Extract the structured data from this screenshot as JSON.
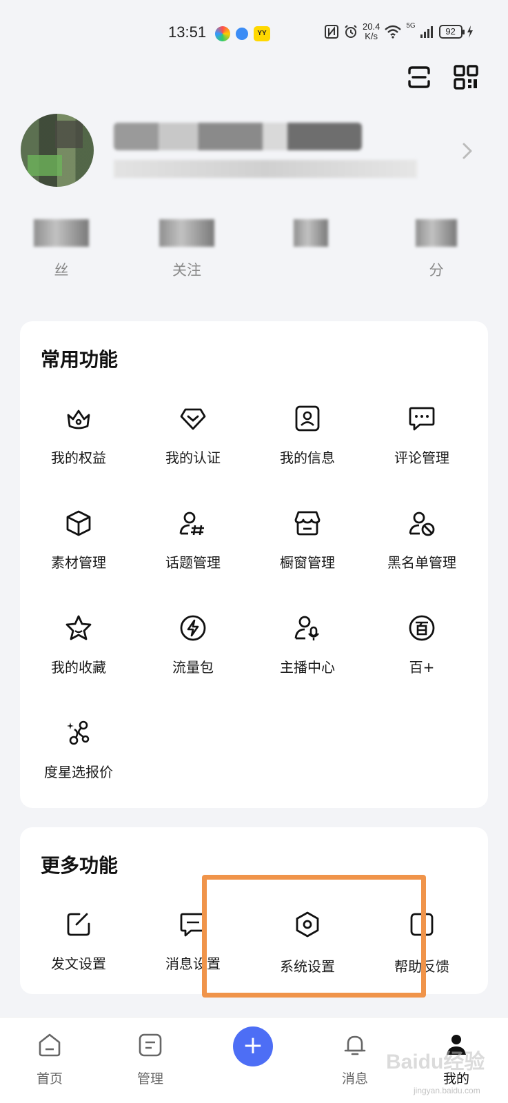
{
  "status_bar": {
    "time": "13:51",
    "net_speed_value": "20.4",
    "net_speed_unit": "K/s",
    "signal": "5G",
    "battery": "92",
    "yy_label": "YY"
  },
  "profile": {
    "stats": [
      {
        "label": "丝"
      },
      {
        "label": "关注"
      },
      {
        "label": ""
      },
      {
        "label": "分"
      }
    ]
  },
  "common_functions": {
    "title": "常用功能",
    "items": [
      {
        "label": "我的权益",
        "icon": "crown-icon"
      },
      {
        "label": "我的认证",
        "icon": "verify-shield-icon"
      },
      {
        "label": "我的信息",
        "icon": "id-card-icon"
      },
      {
        "label": "评论管理",
        "icon": "comment-icon"
      },
      {
        "label": "素材管理",
        "icon": "cube-icon"
      },
      {
        "label": "话题管理",
        "icon": "topic-user-icon"
      },
      {
        "label": "橱窗管理",
        "icon": "shop-window-icon"
      },
      {
        "label": "黑名单管理",
        "icon": "block-user-icon"
      },
      {
        "label": "我的收藏",
        "icon": "star-icon"
      },
      {
        "label": "流量包",
        "icon": "lightning-icon"
      },
      {
        "label": "主播中心",
        "icon": "anchor-mic-icon"
      },
      {
        "label": "百+",
        "icon": "bai-plus-icon"
      },
      {
        "label": "度星选报价",
        "icon": "star-select-icon"
      }
    ]
  },
  "more_functions": {
    "title": "更多功能",
    "items": [
      {
        "label": "发文设置",
        "icon": "edit-icon"
      },
      {
        "label": "消息设置",
        "icon": "message-icon"
      },
      {
        "label": "系统设置",
        "icon": "settings-icon"
      },
      {
        "label": "帮助反馈",
        "icon": "help-icon"
      }
    ]
  },
  "bottom_nav": {
    "items": [
      {
        "label": "首页",
        "icon": "home-icon"
      },
      {
        "label": "管理",
        "icon": "manage-icon"
      },
      {
        "label": "消息",
        "icon": "bell-icon"
      },
      {
        "label": "我的",
        "icon": "profile-icon",
        "active": true
      }
    ],
    "fab_label": "+"
  },
  "watermark": {
    "text": "Baidu经验",
    "sub": "jingyan.baidu.com"
  },
  "colors": {
    "accent": "#4d6ef5",
    "highlight": "#f0944a",
    "background": "#f3f4f7"
  }
}
